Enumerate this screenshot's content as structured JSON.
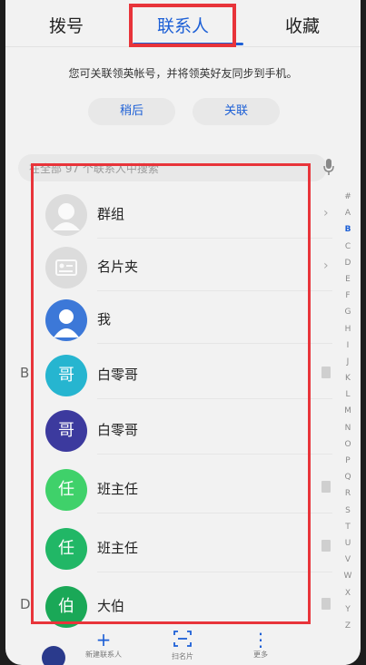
{
  "tabs": [
    {
      "label": "拨号",
      "active": false
    },
    {
      "label": "联系人",
      "active": true
    },
    {
      "label": "收藏",
      "active": false
    }
  ],
  "banner": {
    "text": "您可关联领英帐号，并将领英好友同步到手机。",
    "later_label": "稍后",
    "link_label": "关联"
  },
  "search": {
    "placeholder": "在全部 97 个联系人中搜索"
  },
  "contacts": [
    {
      "label": "群组",
      "avatar": "group",
      "color": "#dcdcdc",
      "trailing": "chevron-right-icon"
    },
    {
      "label": "名片夹",
      "avatar": "card",
      "color": "#dcdcdc",
      "trailing": "chevron-right-icon"
    },
    {
      "label": "我",
      "avatar": "person",
      "color": "#3c78d8",
      "trailing": ""
    },
    {
      "label": "白零哥",
      "avatar_text": "哥",
      "color": "#26b5d0",
      "trailing": "card-icon"
    },
    {
      "label": "白零哥",
      "avatar_text": "哥",
      "color": "#3c3a9e",
      "trailing": ""
    },
    {
      "label": "班主任",
      "avatar_text": "任",
      "color": "#3fd16a",
      "trailing": "card-icon"
    },
    {
      "label": "班主任",
      "avatar_text": "任",
      "color": "#21b766",
      "trailing": "card-icon"
    },
    {
      "label": "大伯",
      "avatar_text": "伯",
      "color": "#1aa857",
      "trailing": "card-icon"
    }
  ],
  "section_letters": [
    "B",
    "D"
  ],
  "index": [
    "#",
    "A",
    "B",
    "C",
    "D",
    "E",
    "F",
    "G",
    "H",
    "I",
    "J",
    "K",
    "L",
    "M",
    "N",
    "O",
    "P",
    "Q",
    "R",
    "S",
    "T",
    "U",
    "V",
    "W",
    "X",
    "Y",
    "Z"
  ],
  "active_index": "B",
  "bottom_bar": {
    "add_label": "新建联系人",
    "scan_label": "扫名片",
    "more_label": "更多"
  },
  "colors": {
    "accent": "#1c5fd6",
    "highlight_box": "#e8343a"
  }
}
